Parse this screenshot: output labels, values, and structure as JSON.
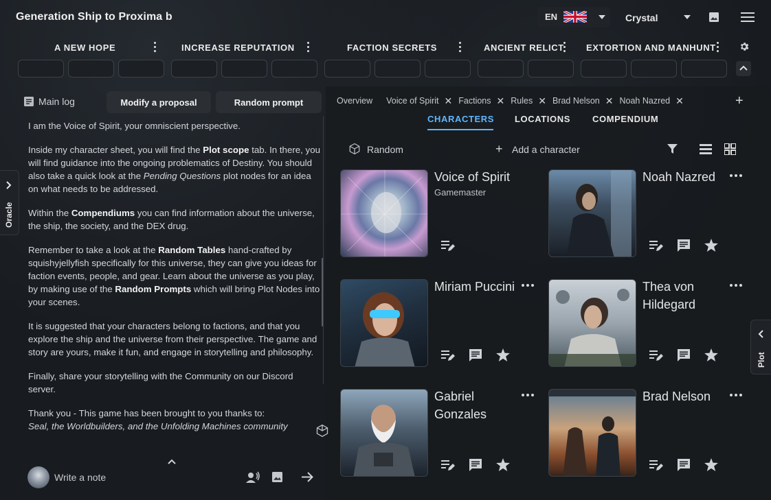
{
  "app": {
    "title": "Generation Ship to Proxima b"
  },
  "header": {
    "language_code": "EN",
    "user_name": "Crystal"
  },
  "threads": [
    {
      "label": "A NEW HOPE"
    },
    {
      "label": "INCREASE REPUTATION"
    },
    {
      "label": "FACTION SECRETS"
    },
    {
      "label": "ANCIENT RELICT"
    },
    {
      "label": "EXTORTION AND MANHUNT"
    }
  ],
  "left": {
    "main_log_label": "Main log",
    "modify_button": "Modify a proposal",
    "random_prompt_button": "Random prompt",
    "note_placeholder": "Write a note",
    "log": {
      "p1": "I am the Voice of Spirit, your omniscient perspective.",
      "p2a": "Inside my character sheet, you will find the ",
      "p2b": "Plot scope",
      "p2c": " tab. In there, you will find guidance into the ongoing problematics of Destiny. You should also take a quick look at the ",
      "p2d": "Pending Questions",
      "p2e": " plot nodes for an idea on what needs to be addressed.",
      "p3a": "Within the ",
      "p3b": "Compendiums",
      "p3c": " you can find information about the universe, the ship, the society, and the DEX drug.",
      "p4a": "Remember to take a look at the ",
      "p4b": "Random Tables",
      "p4c": " hand-crafted by squishyjellyfish specifically for this universe, they can give you ideas for faction events, people, and gear. Learn about the universe as you play, by making use of the ",
      "p4d": "Random Prompts",
      "p4e": " which will bring Plot Nodes into your scenes.",
      "p5": "It is suggested that your characters belong to factions, and that you explore the ship and the universe from their perspective. The game and story are yours, make it fun, and engage in storytelling and philosophy.",
      "p6": "Finally, share your storytelling with the Community on our Discord server.",
      "p7": "Thank you - This game has been brought to you thanks to:",
      "p8": "Seal, the Worldbuilders, and the Unfolding Machines community"
    }
  },
  "side_tabs": {
    "left": "Oracle",
    "right": "Plot"
  },
  "right": {
    "doc_tabs": [
      {
        "label": "Overview"
      },
      {
        "label": "Voice of Spirit"
      },
      {
        "label": "Factions"
      },
      {
        "label": "Rules"
      },
      {
        "label": "Brad Nelson"
      },
      {
        "label": "Noah Nazred"
      }
    ],
    "sub_tabs": [
      "CHARACTERS",
      "LOCATIONS",
      "COMPENDIUM"
    ],
    "random_label": "Random",
    "add_character_label": "Add a character",
    "characters": [
      {
        "name": "Voice of Spirit",
        "role": "Gamemaster"
      },
      {
        "name": "Noah Nazred"
      },
      {
        "name": "Miriam Puccini"
      },
      {
        "name": "Thea von Hildegard"
      },
      {
        "name": "Gabriel Gonzales"
      },
      {
        "name": "Brad Nelson"
      }
    ]
  },
  "colors": {
    "accent": "#5fb6ff",
    "background": "#181b1f"
  }
}
